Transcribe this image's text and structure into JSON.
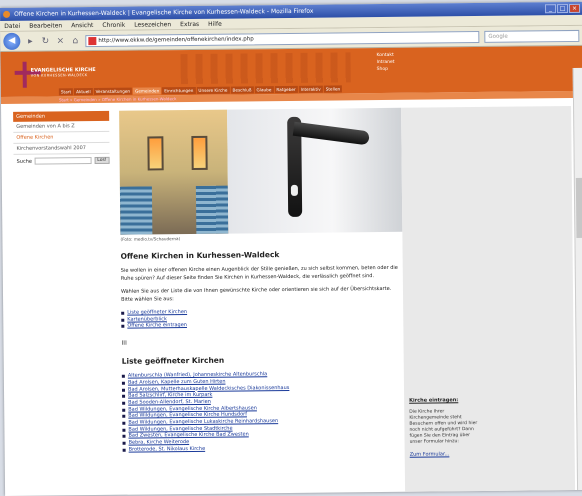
{
  "window": {
    "title": "Offene Kirchen in Kurhessen-Waldeck | Evangelische Kirche von Kurhessen-Waldeck - Mozilla Firefox"
  },
  "menu": [
    "Datei",
    "Bearbeiten",
    "Ansicht",
    "Chronik",
    "Lesezeichen",
    "Extras",
    "Hilfe"
  ],
  "nav": {
    "url": "http://www.ekkw.de/gemeinden/offenekirchen/index.php",
    "search_placeholder": "Google"
  },
  "site": {
    "logo_title": "EVANGELISCHE KIRCHE",
    "logo_sub": "VON KURHESSEN-WALDECK",
    "header_links": [
      "Kontakt",
      "Intranet",
      "Shop"
    ],
    "tabs": [
      "Start",
      "Aktuell",
      "Veranstaltungen",
      "Gemeinden",
      "Einrichtungen",
      "Unsere Kirche",
      "Beschluß",
      "Glaube",
      "Ratgeber",
      "Interaktiv",
      "Stellen"
    ],
    "breadcrumb": "Start » Gemeinden » Offene Kirchen in Kurhessen-Waldeck"
  },
  "sidebar": {
    "heading": "Gemeinden",
    "items": [
      "Gemeinden von A bis Z",
      "Offene Kirchen",
      "Kirchenvorstandswahl 2007"
    ],
    "search_label": "Suche",
    "search_button": "Los!"
  },
  "content": {
    "caption": "(Foto: medio.tv/Schauderna)",
    "title": "Offene Kirchen in Kurhessen-Waldeck",
    "intro": "Sie wollen in einer offenen Kirche einen Augenblick der Stille genießen, zu sich selbst kommen, beten oder die Ruhe spüren? Auf dieser Seite finden Sie Kirchen in Kurhessen-Waldeck, die verlässlich geöffnet sind.",
    "intro2": "Wählen Sie aus der Liste die von Ihnen gewünschte Kirche oder orientieren sie sich auf der Übersichtskarte. Bitte wählen Sie aus:",
    "links": [
      "Liste geöffneter Kirchen",
      "Kartenüberblick",
      "Offene Kirche eintragen"
    ],
    "divider": "III",
    "list_title": "Liste geöffneter Kirchen",
    "churches": [
      "Altenburschla (Wanfried), Johanneskirche Altenburschla",
      "Bad Arolsen, Kapelle zum Guten Hirten",
      "Bad Arolsen, Mutterhauskapelle Waldeckisches Diakonissenhaus",
      "Bad Salzschlirf, Kirche im Kurpark",
      "Bad Sooden-Allendorf, St. Marien",
      "Bad Wildungen, Evangelische Kirche Albertshausen",
      "Bad Wildungen, Evangelische Kirche Hundsdorf",
      "Bad Wildungen, Evangelische Lukaskirche Reinhardshausen",
      "Bad Wildungen, Evangelische Stadtkirche",
      "Bad Zwesten, Evangelische Kirche Bad Zwesten",
      "Bebra, Kirche Weiterode",
      "Brotterode, St. Nikolaus Kirche"
    ]
  },
  "right": {
    "title": "Kirche eintragen:",
    "text": "Die Kirche Ihrer Kirchengemeinde steht Besuchern offen und wird hier noch nicht aufgeführt? Dann fügen Sie den Eintrag über unser Formular hinzu:",
    "link": "Zum Formular..."
  }
}
